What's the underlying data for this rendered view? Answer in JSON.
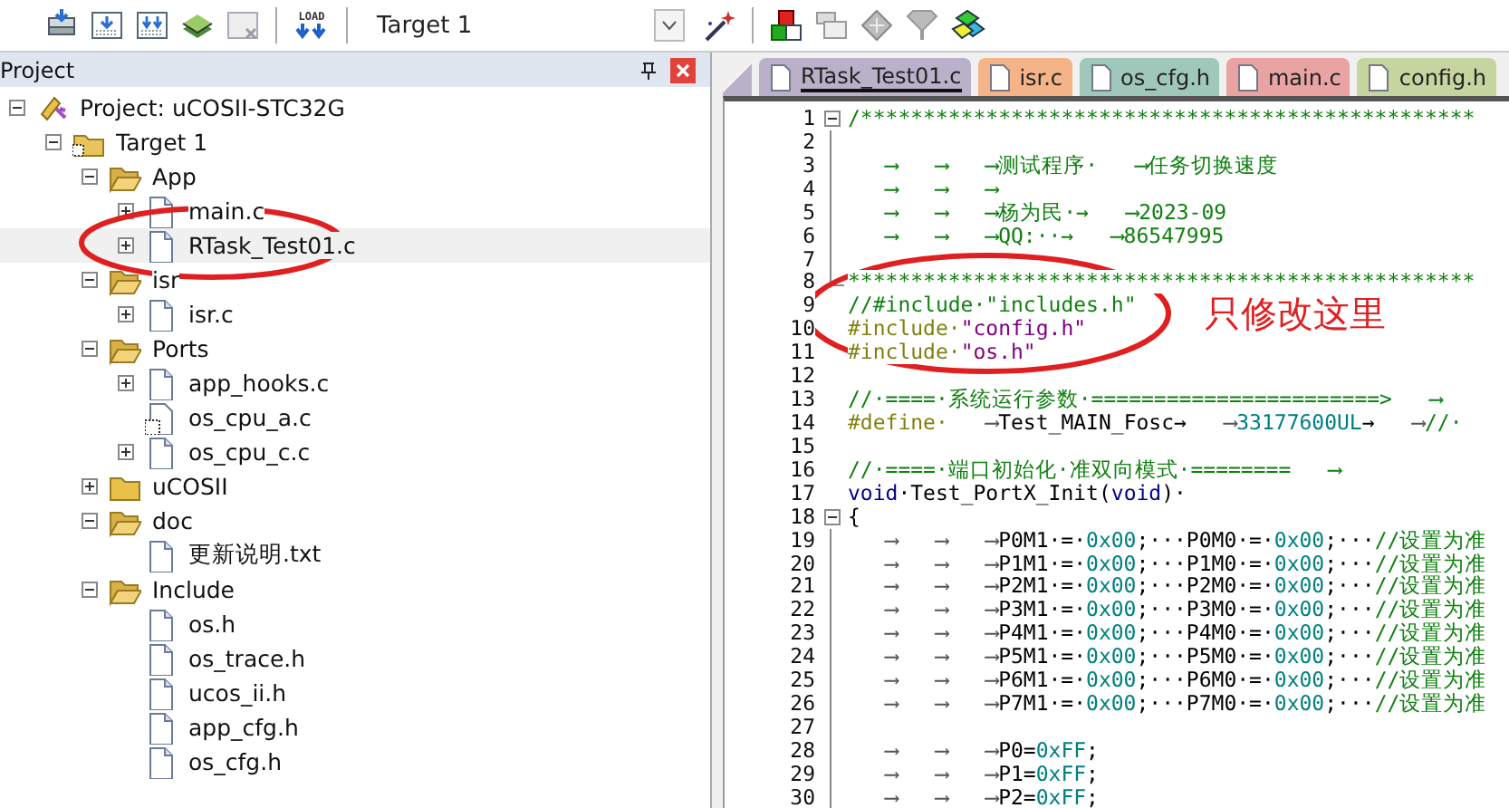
{
  "toolbar": {
    "load_label": "LOAD",
    "target_select": {
      "value": "Target 1"
    }
  },
  "project_panel": {
    "title": "Project",
    "tree": [
      {
        "label": "Project: uCOSII-STC32G",
        "kind": "project",
        "expanded": true,
        "selected": false,
        "children": [
          {
            "label": "Target 1",
            "kind": "target",
            "expanded": true,
            "selected": false,
            "children": [
              {
                "label": "App",
                "kind": "folder",
                "expanded": true,
                "selected": false,
                "children": [
                  {
                    "label": "main.c",
                    "kind": "file",
                    "expanded": false,
                    "selected": false
                  },
                  {
                    "label": "RTask_Test01.c",
                    "kind": "file",
                    "expanded": false,
                    "selected": true
                  }
                ]
              },
              {
                "label": "isr",
                "kind": "folder",
                "expanded": true,
                "selected": false,
                "children": [
                  {
                    "label": "isr.c",
                    "kind": "file",
                    "expanded": false,
                    "selected": false
                  }
                ]
              },
              {
                "label": "Ports",
                "kind": "folder",
                "expanded": true,
                "selected": false,
                "children": [
                  {
                    "label": "app_hooks.c",
                    "kind": "file",
                    "expanded": false,
                    "selected": false
                  },
                  {
                    "label": "os_cpu_a.c",
                    "kind": "asm",
                    "selected": false
                  },
                  {
                    "label": "os_cpu_c.c",
                    "kind": "file",
                    "expanded": false,
                    "selected": false
                  }
                ]
              },
              {
                "label": "uCOSII",
                "kind": "folder",
                "expanded": false,
                "selected": false
              },
              {
                "label": "doc",
                "kind": "folder",
                "expanded": true,
                "selected": false,
                "children": [
                  {
                    "label": "更新说明.txt",
                    "kind": "file",
                    "selected": false
                  }
                ]
              },
              {
                "label": "Include",
                "kind": "folder",
                "expanded": true,
                "selected": false,
                "children": [
                  {
                    "label": "os.h",
                    "kind": "file",
                    "selected": false
                  },
                  {
                    "label": "os_trace.h",
                    "kind": "file",
                    "selected": false
                  },
                  {
                    "label": "ucos_ii.h",
                    "kind": "file",
                    "selected": false
                  },
                  {
                    "label": "app_cfg.h",
                    "kind": "file",
                    "selected": false
                  },
                  {
                    "label": "os_cfg.h",
                    "kind": "file",
                    "selected": false
                  }
                ]
              }
            ]
          }
        ]
      }
    ]
  },
  "editor": {
    "tabs": [
      {
        "label": "RTask_Test01.c",
        "color": "#b9b1c9",
        "selected": true
      },
      {
        "label": "isr.c",
        "color": "#f4b487",
        "selected": false
      },
      {
        "label": "os_cfg.h",
        "color": "#9fc8bb",
        "selected": false
      },
      {
        "label": "main.c",
        "color": "#e9a3a3",
        "selected": false
      },
      {
        "label": "config.h",
        "color": "#c6d49f",
        "selected": false
      }
    ],
    "lines": [
      {
        "number": "1",
        "kind": "fold-start",
        "segments": [
          {
            "kind": "comment",
            "text": "/*************************************************"
          }
        ]
      },
      {
        "number": "2",
        "kind": "fold-body"
      },
      {
        "number": "3",
        "kind": "fold-body",
        "segments": [
          {
            "kind": "comment-tab",
            "text": "⟶"
          },
          {
            "kind": "comment-tab",
            "text": "⟶"
          },
          {
            "kind": "comment-tab",
            "text": "⟶"
          },
          {
            "kind": "comment",
            "text": "测试程序·"
          },
          {
            "kind": "comment-tab",
            "text": "⟶"
          },
          {
            "kind": "comment",
            "text": "任务切换速度"
          }
        ]
      },
      {
        "number": "4",
        "kind": "fold-body",
        "segments": [
          {
            "kind": "comment-tab",
            "text": "⟶"
          },
          {
            "kind": "comment-tab",
            "text": "⟶"
          },
          {
            "kind": "comment-tab",
            "text": "⟶"
          }
        ]
      },
      {
        "number": "5",
        "kind": "fold-body",
        "segments": [
          {
            "kind": "comment-tab",
            "text": "⟶"
          },
          {
            "kind": "comment-tab",
            "text": "⟶"
          },
          {
            "kind": "comment-tab",
            "text": "⟶"
          },
          {
            "kind": "comment",
            "text": "杨为民·→"
          },
          {
            "kind": "comment-tab",
            "text": "⟶"
          },
          {
            "kind": "comment",
            "text": "2023-09"
          }
        ]
      },
      {
        "number": "6",
        "kind": "fold-body",
        "segments": [
          {
            "kind": "comment-tab",
            "text": "⟶"
          },
          {
            "kind": "comment-tab",
            "text": "⟶"
          },
          {
            "kind": "comment-tab",
            "text": "⟶"
          },
          {
            "kind": "comment",
            "text": "QQ:··→"
          },
          {
            "kind": "comment-tab",
            "text": "⟶"
          },
          {
            "kind": "comment",
            "text": "86547995"
          }
        ]
      },
      {
        "number": "7",
        "kind": "fold-body"
      },
      {
        "number": "8",
        "kind": "fold-end",
        "segments": [
          {
            "kind": "comment",
            "text": "**************************************************"
          }
        ]
      },
      {
        "number": "9",
        "kind": "plain",
        "segments": [
          {
            "kind": "comment",
            "text": "//#include·\"includes.h\""
          }
        ]
      },
      {
        "number": "10",
        "kind": "plain",
        "segments": [
          {
            "kind": "preproc",
            "text": "#include·"
          },
          {
            "kind": "string",
            "text": "\"config.h\""
          }
        ]
      },
      {
        "number": "11",
        "kind": "plain",
        "segments": [
          {
            "kind": "preproc",
            "text": "#include·"
          },
          {
            "kind": "string",
            "text": "\"os.h\""
          }
        ]
      },
      {
        "number": "12",
        "kind": "plain"
      },
      {
        "number": "13",
        "kind": "plain",
        "segments": [
          {
            "kind": "comment",
            "text": "//·====·系统运行参数·=======================>"
          },
          {
            "kind": "comment-tab",
            "text": "⟶"
          }
        ]
      },
      {
        "number": "14",
        "kind": "plain",
        "segments": [
          {
            "kind": "preproc",
            "text": "#define·"
          },
          {
            "kind": "tab",
            "text": "⟶"
          },
          {
            "kind": "plain",
            "text": "Test_MAIN_Fosc→"
          },
          {
            "kind": "tab",
            "text": "⟶"
          },
          {
            "kind": "number",
            "text": "33177600UL"
          },
          {
            "kind": "plain",
            "text": "→"
          },
          {
            "kind": "tab",
            "text": "⟶"
          },
          {
            "kind": "comment",
            "text": "//·"
          }
        ]
      },
      {
        "number": "15",
        "kind": "plain"
      },
      {
        "number": "16",
        "kind": "plain",
        "segments": [
          {
            "kind": "comment",
            "text": "//·====·端口初始化·准双向模式·========"
          },
          {
            "kind": "comment-tab",
            "text": "⟶"
          }
        ]
      },
      {
        "number": "17",
        "kind": "plain",
        "segments": [
          {
            "kind": "keyword",
            "text": "void"
          },
          {
            "kind": "plain",
            "text": "·Test_PortX_Init("
          },
          {
            "kind": "keyword",
            "text": "void"
          },
          {
            "kind": "plain",
            "text": ")·"
          }
        ]
      },
      {
        "number": "18",
        "kind": "fold-start",
        "segments": [
          {
            "kind": "plain",
            "text": "{"
          }
        ]
      },
      {
        "number": "19",
        "kind": "fold-body",
        "segments": [
          {
            "kind": "tab",
            "text": "⟶"
          },
          {
            "kind": "tab",
            "text": "⟶"
          },
          {
            "kind": "tab",
            "text": "⟶"
          },
          {
            "kind": "plain",
            "text": "P0M1·=·"
          },
          {
            "kind": "number",
            "text": "0x00"
          },
          {
            "kind": "plain",
            "text": ";···P0M0·=·"
          },
          {
            "kind": "number",
            "text": "0x00"
          },
          {
            "kind": "plain",
            "text": ";···"
          },
          {
            "kind": "comment",
            "text": "//设置为准"
          }
        ]
      },
      {
        "number": "20",
        "kind": "fold-body",
        "segments": [
          {
            "kind": "tab",
            "text": "⟶"
          },
          {
            "kind": "tab",
            "text": "⟶"
          },
          {
            "kind": "tab",
            "text": "⟶"
          },
          {
            "kind": "plain",
            "text": "P1M1·=·"
          },
          {
            "kind": "number",
            "text": "0x00"
          },
          {
            "kind": "plain",
            "text": ";···P1M0·=·"
          },
          {
            "kind": "number",
            "text": "0x00"
          },
          {
            "kind": "plain",
            "text": ";···"
          },
          {
            "kind": "comment",
            "text": "//设置为准"
          }
        ]
      },
      {
        "number": "21",
        "kind": "fold-body",
        "segments": [
          {
            "kind": "tab",
            "text": "⟶"
          },
          {
            "kind": "tab",
            "text": "⟶"
          },
          {
            "kind": "tab",
            "text": "⟶"
          },
          {
            "kind": "plain",
            "text": "P2M1·=·"
          },
          {
            "kind": "number",
            "text": "0x00"
          },
          {
            "kind": "plain",
            "text": ";···P2M0·=·"
          },
          {
            "kind": "number",
            "text": "0x00"
          },
          {
            "kind": "plain",
            "text": ";···"
          },
          {
            "kind": "comment",
            "text": "//设置为准"
          }
        ]
      },
      {
        "number": "22",
        "kind": "fold-body",
        "segments": [
          {
            "kind": "tab",
            "text": "⟶"
          },
          {
            "kind": "tab",
            "text": "⟶"
          },
          {
            "kind": "tab",
            "text": "⟶"
          },
          {
            "kind": "plain",
            "text": "P3M1·=·"
          },
          {
            "kind": "number",
            "text": "0x00"
          },
          {
            "kind": "plain",
            "text": ";···P3M0·=·"
          },
          {
            "kind": "number",
            "text": "0x00"
          },
          {
            "kind": "plain",
            "text": ";···"
          },
          {
            "kind": "comment",
            "text": "//设置为准"
          }
        ]
      },
      {
        "number": "23",
        "kind": "fold-body",
        "segments": [
          {
            "kind": "tab",
            "text": "⟶"
          },
          {
            "kind": "tab",
            "text": "⟶"
          },
          {
            "kind": "tab",
            "text": "⟶"
          },
          {
            "kind": "plain",
            "text": "P4M1·=·"
          },
          {
            "kind": "number",
            "text": "0x00"
          },
          {
            "kind": "plain",
            "text": ";···P4M0·=·"
          },
          {
            "kind": "number",
            "text": "0x00"
          },
          {
            "kind": "plain",
            "text": ";···"
          },
          {
            "kind": "comment",
            "text": "//设置为准"
          }
        ]
      },
      {
        "number": "24",
        "kind": "fold-body",
        "segments": [
          {
            "kind": "tab",
            "text": "⟶"
          },
          {
            "kind": "tab",
            "text": "⟶"
          },
          {
            "kind": "tab",
            "text": "⟶"
          },
          {
            "kind": "plain",
            "text": "P5M1·=·"
          },
          {
            "kind": "number",
            "text": "0x00"
          },
          {
            "kind": "plain",
            "text": ";···P5M0·=·"
          },
          {
            "kind": "number",
            "text": "0x00"
          },
          {
            "kind": "plain",
            "text": ";···"
          },
          {
            "kind": "comment",
            "text": "//设置为准"
          }
        ]
      },
      {
        "number": "25",
        "kind": "fold-body",
        "segments": [
          {
            "kind": "tab",
            "text": "⟶"
          },
          {
            "kind": "tab",
            "text": "⟶"
          },
          {
            "kind": "tab",
            "text": "⟶"
          },
          {
            "kind": "plain",
            "text": "P6M1·=·"
          },
          {
            "kind": "number",
            "text": "0x00"
          },
          {
            "kind": "plain",
            "text": ";···P6M0·=·"
          },
          {
            "kind": "number",
            "text": "0x00"
          },
          {
            "kind": "plain",
            "text": ";···"
          },
          {
            "kind": "comment",
            "text": "//设置为准"
          }
        ]
      },
      {
        "number": "26",
        "kind": "fold-body",
        "segments": [
          {
            "kind": "tab",
            "text": "⟶"
          },
          {
            "kind": "tab",
            "text": "⟶"
          },
          {
            "kind": "tab",
            "text": "⟶"
          },
          {
            "kind": "plain",
            "text": "P7M1·=·"
          },
          {
            "kind": "number",
            "text": "0x00"
          },
          {
            "kind": "plain",
            "text": ";···P7M0·=·"
          },
          {
            "kind": "number",
            "text": "0x00"
          },
          {
            "kind": "plain",
            "text": ";···"
          },
          {
            "kind": "comment",
            "text": "//设置为准"
          }
        ]
      },
      {
        "number": "27",
        "kind": "fold-body"
      },
      {
        "number": "28",
        "kind": "fold-body",
        "segments": [
          {
            "kind": "tab",
            "text": "⟶"
          },
          {
            "kind": "tab",
            "text": "⟶"
          },
          {
            "kind": "tab",
            "text": "⟶"
          },
          {
            "kind": "plain",
            "text": "P0="
          },
          {
            "kind": "number",
            "text": "0xFF"
          },
          {
            "kind": "plain",
            "text": ";"
          }
        ]
      },
      {
        "number": "29",
        "kind": "fold-body",
        "segments": [
          {
            "kind": "tab",
            "text": "⟶"
          },
          {
            "kind": "tab",
            "text": "⟶"
          },
          {
            "kind": "tab",
            "text": "⟶"
          },
          {
            "kind": "plain",
            "text": "P1="
          },
          {
            "kind": "number",
            "text": "0xFF"
          },
          {
            "kind": "plain",
            "text": ";"
          }
        ]
      },
      {
        "number": "30",
        "kind": "fold-body",
        "segments": [
          {
            "kind": "tab",
            "text": "⟶"
          },
          {
            "kind": "tab",
            "text": "⟶"
          },
          {
            "kind": "tab",
            "text": "⟶"
          },
          {
            "kind": "plain",
            "text": "P2="
          },
          {
            "kind": "number",
            "text": "0xFF"
          },
          {
            "kind": "plain",
            "text": ";"
          }
        ]
      }
    ]
  },
  "annotation": {
    "note": "只修改这里"
  }
}
